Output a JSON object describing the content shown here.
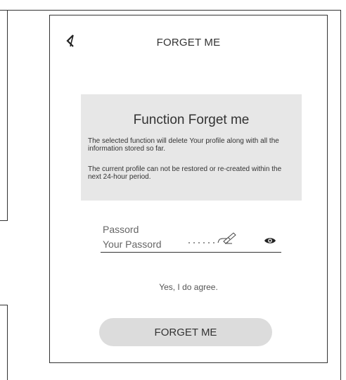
{
  "header": {
    "title": "FORGET ME"
  },
  "info": {
    "title": "Function Forget me",
    "paragraph1": "The selected function will delete Your profile along with all the information stored so far.",
    "paragraph2": "The current profile can not be restored or re-created within the next 24-hour period."
  },
  "password": {
    "label": "Passord",
    "placeholder": "Your Passord",
    "icons": [
      "pen-icon",
      "eye-icon"
    ]
  },
  "agreement": {
    "text": "Yes, I do agree."
  },
  "action": {
    "button_label": "FORGET ME"
  }
}
